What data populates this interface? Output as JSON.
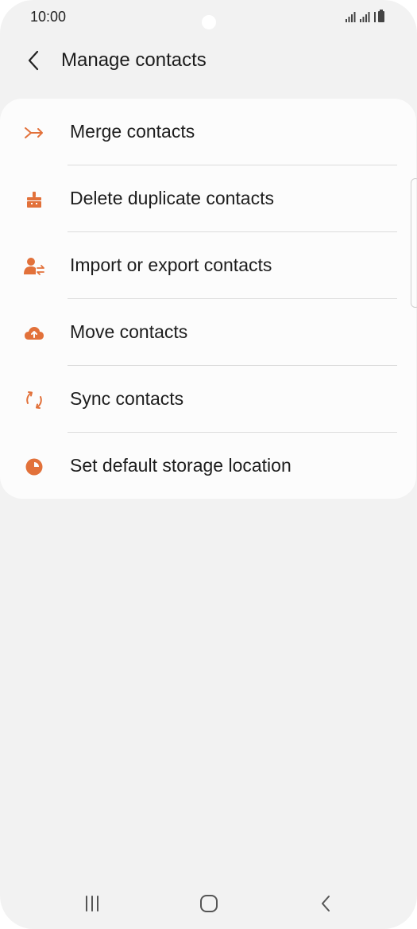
{
  "status_bar": {
    "time": "10:00"
  },
  "header": {
    "title": "Manage contacts",
    "back_icon": "chevron-left-icon"
  },
  "accent_color": "#e2713a",
  "menu": {
    "items": [
      {
        "label": "Merge contacts",
        "icon": "merge-icon"
      },
      {
        "label": "Delete duplicate contacts",
        "icon": "broom-icon"
      },
      {
        "label": "Import or export contacts",
        "icon": "person-transfer-icon"
      },
      {
        "label": "Move contacts",
        "icon": "cloud-upload-icon"
      },
      {
        "label": "Sync contacts",
        "icon": "sync-icon"
      },
      {
        "label": "Set default storage location",
        "icon": "pie-chart-icon"
      }
    ]
  },
  "nav_bar": {
    "recents_icon": "recents-icon",
    "home_icon": "home-icon",
    "back_icon": "back-icon"
  }
}
